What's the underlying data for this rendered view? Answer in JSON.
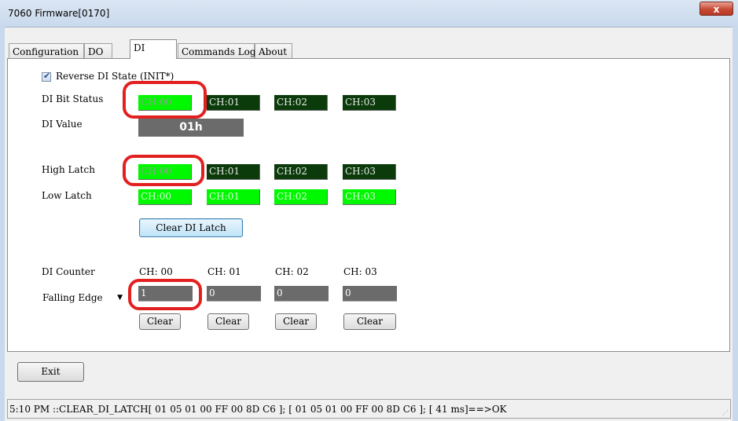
{
  "window": {
    "title": "7060 Firmware[0170]",
    "close_label": "x"
  },
  "tabs": [
    {
      "label": "Configuration"
    },
    {
      "label": "DO"
    },
    {
      "label": "DI",
      "active": true
    },
    {
      "label": "Commands Log"
    },
    {
      "label": "About"
    }
  ],
  "di": {
    "reverse_label": "Reverse DI State  (INIT*)",
    "reverse_checked": true,
    "bit_status_label": "DI Bit Status",
    "bit_status": [
      {
        "label": "CH:00",
        "state": "on"
      },
      {
        "label": "CH:01",
        "state": "off"
      },
      {
        "label": "CH:02",
        "state": "off"
      },
      {
        "label": "CH:03",
        "state": "off"
      }
    ],
    "value_label": "DI Value",
    "value": "01h",
    "high_latch_label": "High Latch",
    "high_latch": [
      {
        "label": "CH:00",
        "state": "on"
      },
      {
        "label": "CH:01",
        "state": "off"
      },
      {
        "label": "CH:02",
        "state": "off"
      },
      {
        "label": "CH:03",
        "state": "off"
      }
    ],
    "low_latch_label": "Low Latch",
    "low_latch": [
      {
        "label": "CH:00",
        "state": "on"
      },
      {
        "label": "CH:01",
        "state": "on"
      },
      {
        "label": "CH:02",
        "state": "on"
      },
      {
        "label": "CH:03",
        "state": "on"
      }
    ],
    "clear_latch_label": "Clear DI Latch",
    "counter_label": "DI Counter",
    "counter_headers": [
      "CH: 00",
      "CH: 01",
      "CH: 02",
      "CH: 03"
    ],
    "counter_values": [
      "1",
      "0",
      "0",
      "0"
    ],
    "counter_mode": "Falling Edge",
    "clear_label": "Clear"
  },
  "footer": {
    "exit_label": "Exit",
    "status_text": "5:10 PM ::CLEAR_DI_LATCH[ 01 05 01 00 FF 00 8D C6 ]; [ 01 05 01 00 FF 00 8D C6  ]; [ 41 ms]==>OK"
  },
  "colors": {
    "indicator_on": "#00f800",
    "indicator_off": "#0b3b0b",
    "value_box": "#6b6b6b",
    "highlight_ring": "#e32020"
  }
}
